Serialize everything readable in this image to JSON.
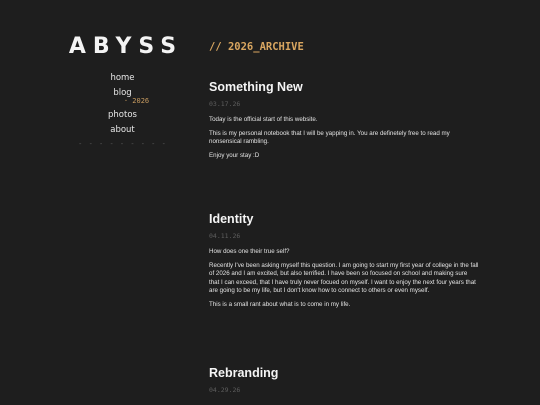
{
  "site": {
    "logo": "ABYSS"
  },
  "nav": {
    "home": "home",
    "blog": "blog",
    "blog_sub": "· 2026",
    "photos": "photos",
    "about": "about",
    "divider": "- - - - - - - - -"
  },
  "main": {
    "archive_title": "// 2026_ARCHIVE",
    "posts": [
      {
        "title": "Something New",
        "date": "03.17.26",
        "paragraphs": [
          "Today is the official start of this website.",
          "This is my personal notebook that I will be yapping in. You are definetely free to read my nonsensical rambling.",
          "Enjoy your stay :D"
        ]
      },
      {
        "title": "Identity",
        "date": "04.11.26",
        "paragraphs": [
          "How does one their true self?",
          "Recently I've been asking myself this question. I am going to start my first year of college in the fall of 2026 and I am excited, but also terrified. I have been so focused on school and making sure that I can exceed, that I have truly never focued on myself. I want to enjoy the next four years that are going to be my life, but I don't know how to connect to others or even myself.",
          "This is a small rant about what is to come in my life."
        ]
      },
      {
        "title": "Rebranding",
        "date": "04.29.26",
        "paragraphs": []
      }
    ]
  }
}
